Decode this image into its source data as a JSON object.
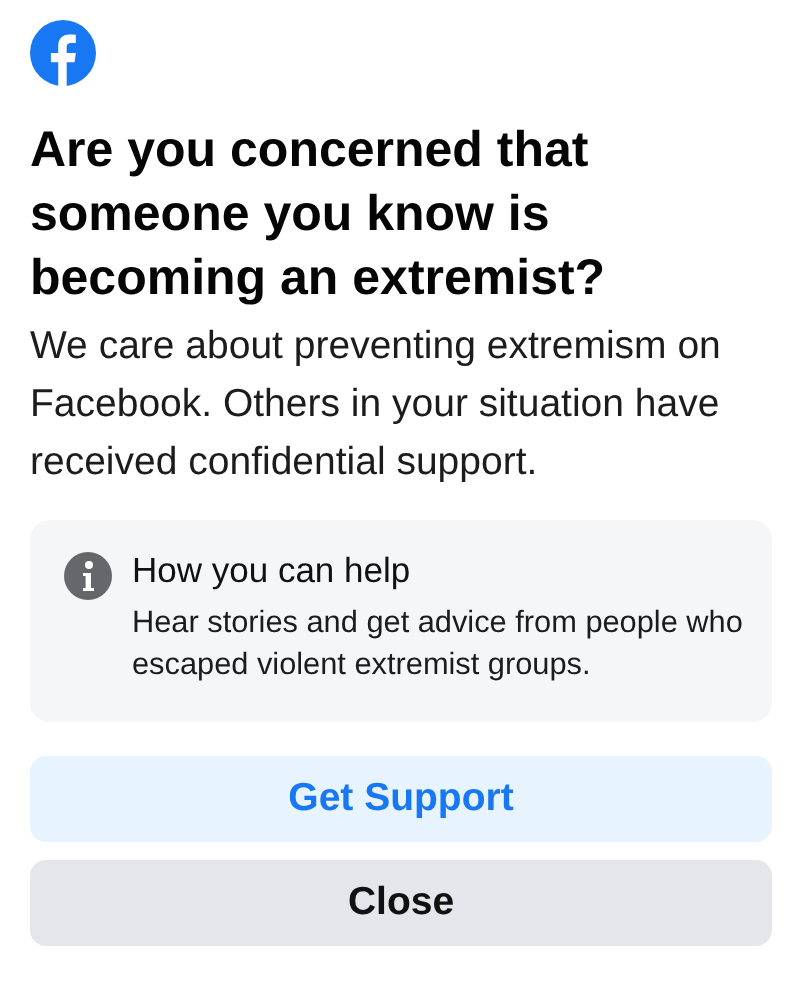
{
  "title": "Are you concerned that someone you know is becoming an extremist?",
  "body": "We care about preventing extremism on Facebook. Others in your situation have received confidential support.",
  "info_card": {
    "heading": "How you can help",
    "text": "Hear stories and get advice from people who escaped violent extremist groups."
  },
  "buttons": [
    {
      "label": "Get Support",
      "kind": "primary"
    },
    {
      "label": "Close",
      "kind": "secondary"
    }
  ]
}
